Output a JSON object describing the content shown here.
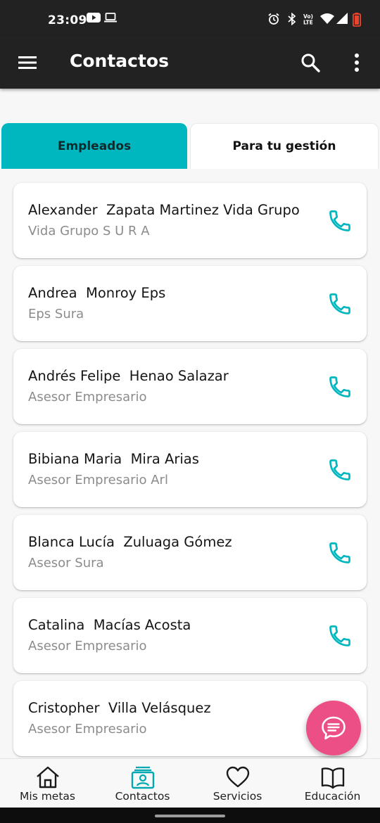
{
  "status_bar": {
    "time": "23:09",
    "icons": [
      "youtube-icon",
      "laptop-icon",
      "alarm-icon",
      "bluetooth-icon",
      "volte-icon",
      "wifi-icon",
      "signal-icon",
      "battery-icon"
    ],
    "volte_text": "VoLTE"
  },
  "app_bar": {
    "title": "Contactos",
    "icons": [
      "menu-icon",
      "search-icon",
      "more-vert-icon"
    ]
  },
  "tabs": [
    {
      "label": "Empleados",
      "active": true
    },
    {
      "label": "Para tu gestión",
      "active": false
    }
  ],
  "contacts": [
    {
      "name": "Alexander  Zapata Martinez Vida Grupo",
      "role": "Vida Grupo S U R A"
    },
    {
      "name": "Andrea  Monroy Eps",
      "role": "Eps Sura"
    },
    {
      "name": "Andrés Felipe  Henao Salazar",
      "role": "Asesor Empresario"
    },
    {
      "name": "Bibiana Maria  Mira Arias",
      "role": "Asesor Empresario Arl"
    },
    {
      "name": "Blanca Lucía  Zuluaga Gómez",
      "role": "Asesor Sura"
    },
    {
      "name": "Catalina  Macías Acosta",
      "role": "Asesor Empresario"
    },
    {
      "name": "Cristopher  Villa Velásquez",
      "role": "Asesor Empresario"
    }
  ],
  "fab": {
    "icon": "chat-icon"
  },
  "bottom_nav": [
    {
      "label": "Mis metas",
      "icon": "home-icon",
      "active": false
    },
    {
      "label": "Contactos",
      "icon": "contacts-icon",
      "active": true
    },
    {
      "label": "Servicios",
      "icon": "heart-icon",
      "active": false
    },
    {
      "label": "Educación",
      "icon": "book-icon",
      "active": false
    }
  ],
  "colors": {
    "accent": "#00b6bf",
    "appbar": "#222222",
    "fab": "#ec4f86",
    "phone_icon": "#00b6bf"
  }
}
